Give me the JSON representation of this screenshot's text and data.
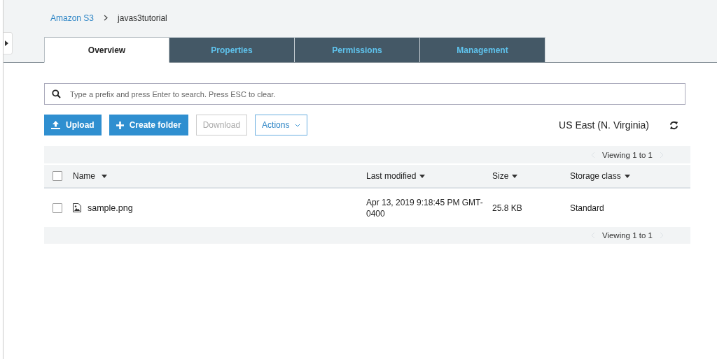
{
  "breadcrumb": [
    {
      "label": "Amazon S3",
      "link": true
    },
    {
      "label": "javas3tutorial",
      "link": false
    }
  ],
  "tabs": [
    {
      "label": "Overview",
      "selected": true
    },
    {
      "label": "Properties",
      "selected": false
    },
    {
      "label": "Permissions",
      "selected": false
    },
    {
      "label": "Management",
      "selected": false
    }
  ],
  "search": {
    "placeholder": "Type a prefix and press Enter to search. Press ESC to clear."
  },
  "buttons": [
    {
      "label": "Upload",
      "kind": "upload",
      "disabled": false
    },
    {
      "label": "Create folder",
      "kind": "create",
      "disabled": false
    },
    {
      "label": "Download",
      "kind": "plain",
      "disabled": true
    },
    {
      "label": "Actions",
      "kind": "dropdown",
      "disabled": false
    }
  ],
  "region": "US East (N. Virginia)",
  "pagination_top": "Viewing 1 to 1",
  "table": {
    "all_checked": false,
    "columns": [
      "Name",
      "Last modified",
      "Size",
      "Storage class"
    ],
    "rows": [
      {
        "checked": false,
        "cells": [
          "sample.png",
          "Apr 13, 2019 9:18:45 PM GMT-0400",
          "25.8 KB",
          "Standard"
        ]
      }
    ]
  },
  "pagination_bottom": "Viewing 1 to 1"
}
